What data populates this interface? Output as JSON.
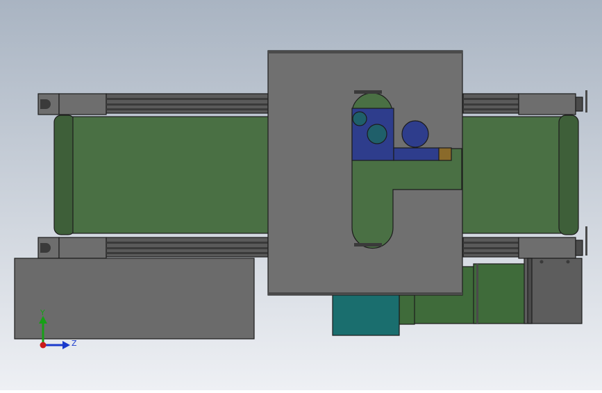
{
  "viewport": {
    "background_top": "#a9b4c2",
    "background_bottom": "#eef0f4"
  },
  "colors": {
    "belt": "#4a7044",
    "belt_dark": "#3e5f39",
    "frame_gray": "#6e6e6e",
    "frame_dark": "#4a4a4a",
    "rail": "#5a5a5a",
    "slot": "#3a3a3a",
    "plate": "#707070",
    "cover_box": "#6b6b6b",
    "bracket_dark": "#555555",
    "navy_block": "#2e3d8c",
    "teal_roller": "#1f5f6a",
    "teal_cylinder": "#1a6e6e",
    "motor_green": "#3f6b3a",
    "gearbox_gray": "#5d5d5d",
    "brown_pad": "#8a6a2a",
    "outline": "#1c1c1c",
    "axis_y": "#16a016",
    "axis_z": "#1a3acc",
    "axis_origin": "#cc1a1a"
  },
  "triad": {
    "y_label": "Y",
    "z_label": "Z"
  }
}
